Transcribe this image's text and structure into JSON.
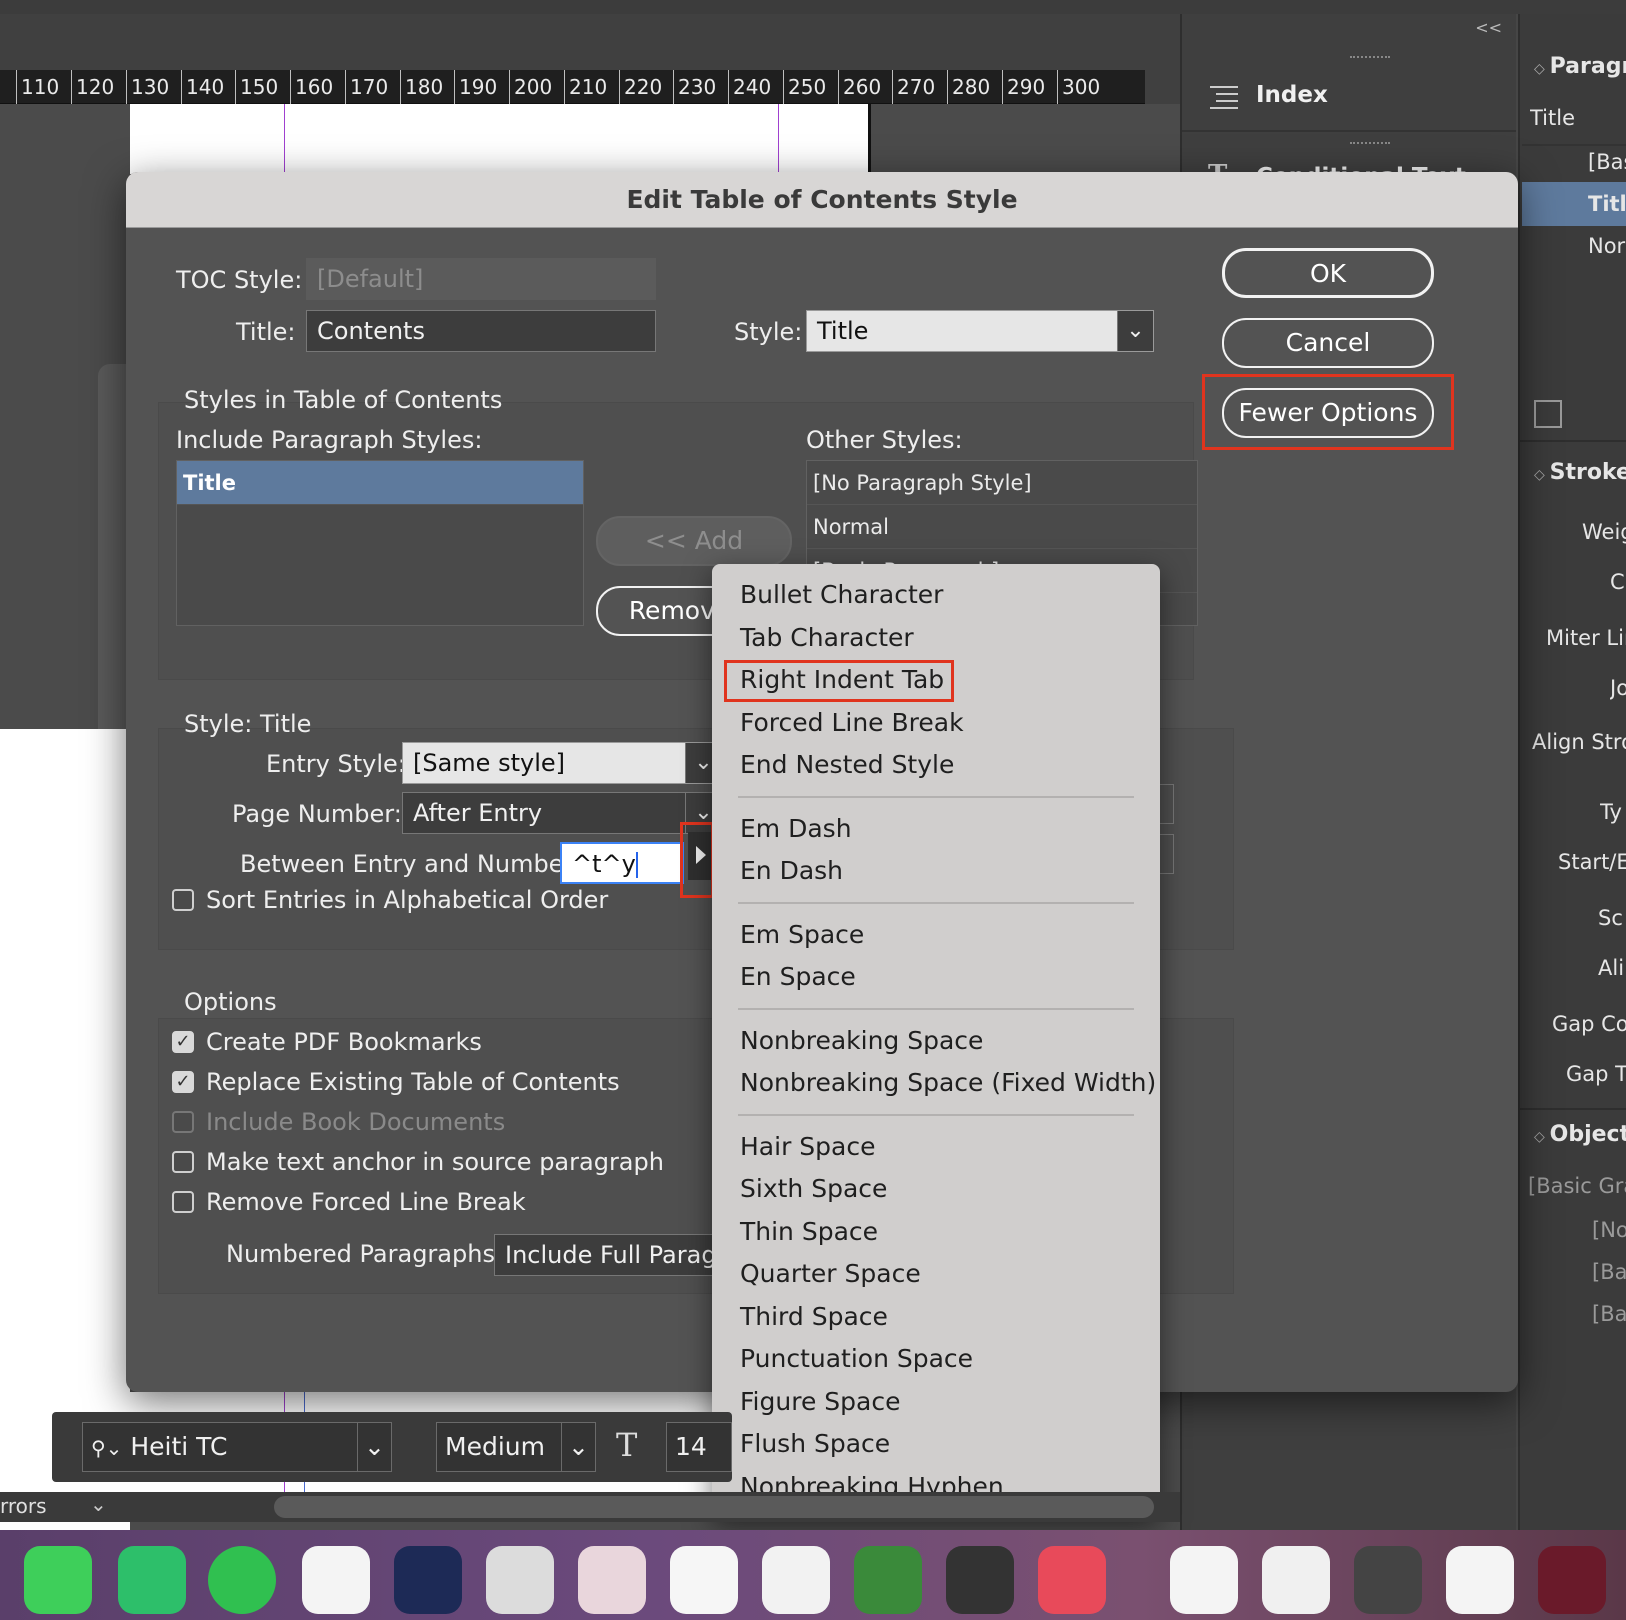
{
  "ruler": {
    "labels": [
      "110",
      "120",
      "130",
      "140",
      "150",
      "160",
      "170",
      "180",
      "190",
      "200",
      "210",
      "220",
      "230",
      "240",
      "250",
      "260",
      "270",
      "280",
      "290",
      "300"
    ]
  },
  "panels": {
    "collapse_glyph": "<<",
    "index_label": "Index",
    "conditional_label": "Conditional Text",
    "paragraph_header": "Paragr",
    "paragraph_items": [
      "Title",
      "[Bas",
      "Titl",
      "Nor"
    ],
    "stroke_header": "Stroke",
    "stroke_items": [
      "Weig",
      "C",
      "Miter Lir",
      "Jo",
      "Align Stro",
      "Ty",
      "Start/E",
      "Sc",
      "Ali",
      "Gap Co",
      "Gap T"
    ],
    "object_header": "Object",
    "object_items": [
      "[Basic Gra",
      "[No",
      "[Ba",
      "[Ba"
    ]
  },
  "dialog": {
    "title": "Edit Table of Contents Style",
    "toc_style_label": "TOC Style:",
    "toc_style_value": "[Default]",
    "title_label": "Title:",
    "title_value": "Contents",
    "style_label": "Style:",
    "style_value": "Title",
    "styles_group_label": "Styles in Table of Contents",
    "include_label": "Include Paragraph Styles:",
    "include_items": [
      "Title"
    ],
    "add_button": "<< Add",
    "remove_button": "Remove >",
    "other_label": "Other Styles:",
    "other_items": [
      "[No Paragraph Style]",
      "Normal",
      "[Basic Paragraph]"
    ],
    "style_section_label": "Style: Title",
    "entry_style_label": "Entry Style:",
    "entry_style_value": "[Same style]",
    "page_number_label": "Page Number:",
    "page_number_value": "After Entry",
    "between_label": "Between Entry and Number:",
    "between_value": "^t^y",
    "sort_label": "Sort Entries in Alphabetical Order",
    "options_label": "Options",
    "opt_pdf": "Create PDF Bookmarks",
    "opt_replace": "Replace Existing Table of Contents",
    "opt_book": "Include Book Documents",
    "opt_anchor": "Make text anchor in source paragraph",
    "opt_remove_break": "Remove Forced Line Break",
    "numbered_label": "Numbered Paragraphs:",
    "numbered_value": "Include Full Paragra",
    "ok_button": "OK",
    "cancel_button": "Cancel",
    "fewer_button": "Fewer Options"
  },
  "menu": {
    "items": [
      "Bullet Character",
      "Tab Character",
      "Right Indent Tab",
      "Forced Line Break",
      "End Nested Style",
      "Em Dash",
      "En Dash",
      "Em Space",
      "En Space",
      "Nonbreaking Space",
      "Nonbreaking Space (Fixed Width)",
      "Hair Space",
      "Sixth Space",
      "Thin Space",
      "Quarter Space",
      "Third Space",
      "Punctuation Space",
      "Figure Space",
      "Flush Space",
      "Nonbreaking Hyphen"
    ]
  },
  "controlbar": {
    "font_value": "Heiti TC",
    "weight_value": "Medium",
    "size_value": "14"
  },
  "statusbar": {
    "errors_label": "rrors"
  },
  "colors": {
    "highlight": "#e0341e",
    "selection": "#5e7a9d"
  }
}
